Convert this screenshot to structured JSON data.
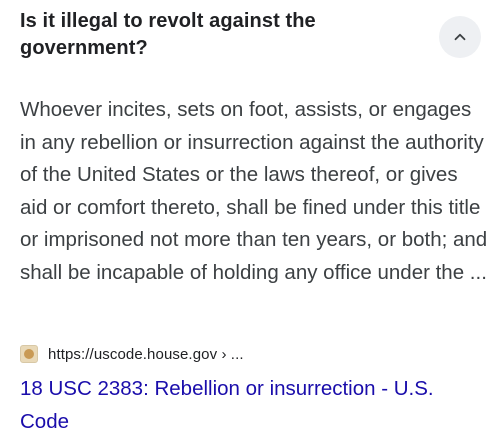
{
  "question": {
    "title": "Is it illegal to revolt against the government?",
    "toggle_icon": "chevron-up-icon"
  },
  "answer": {
    "text": "Whoever incites, sets on foot, assists, or engages in any rebellion or insurrection against the authority of the United States or the laws thereof, or gives aid or comfort thereto, shall be fined under this title or imprisoned not more than ten years, or both; and shall be incapable of holding any office under the ..."
  },
  "source": {
    "favicon": "site-favicon-icon",
    "url": "https://uscode.house.gov › ..."
  },
  "result": {
    "title": "18 USC 2383: Rebellion or insurrection - U.S. Code"
  },
  "colors": {
    "link": "#1a0dab",
    "toggle_background": "#eef0f3",
    "body_text": "#3c4043"
  }
}
